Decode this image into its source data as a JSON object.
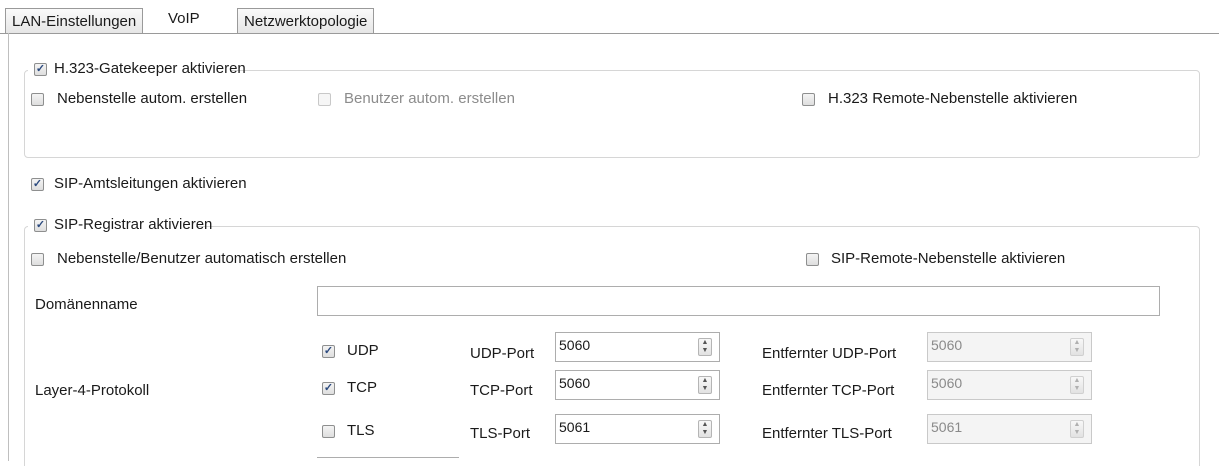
{
  "tabs": [
    {
      "label": "LAN-Einstellungen",
      "active": false
    },
    {
      "label": "VoIP",
      "active": true
    },
    {
      "label": "Netzwerktopologie",
      "active": false
    }
  ],
  "h323": {
    "title": "H.323-Gatekeeper aktivieren",
    "title_checked": true,
    "auto_extension": {
      "label": "Nebenstelle autom. erstellen",
      "checked": false
    },
    "auto_user": {
      "label": "Benutzer autom. erstellen",
      "checked": false,
      "disabled": true
    },
    "remote_extension": {
      "label": "H.323 Remote-Nebenstelle aktivieren",
      "checked": false
    }
  },
  "sip_trunks": {
    "label": "SIP-Amtsleitungen aktivieren",
    "checked": true
  },
  "sip_registrar": {
    "title": "SIP-Registrar aktivieren",
    "title_checked": true,
    "auto_create": {
      "label": "Nebenstelle/Benutzer automatisch erstellen",
      "checked": false
    },
    "remote_extension": {
      "label": "SIP-Remote-Nebenstelle aktivieren",
      "checked": false
    },
    "domain_label": "Domänenname",
    "domain_value": "",
    "layer4_label": "Layer-4-Protokoll",
    "protocols": [
      {
        "name": "UDP",
        "checked": true,
        "port_label": "UDP-Port",
        "port": "5060",
        "remote_label": "Entfernter UDP-Port",
        "remote_port": "5060"
      },
      {
        "name": "TCP",
        "checked": true,
        "port_label": "TCP-Port",
        "port": "5060",
        "remote_label": "Entfernter TCP-Port",
        "remote_port": "5060"
      },
      {
        "name": "TLS",
        "checked": false,
        "port_label": "TLS-Port",
        "port": "5061",
        "remote_label": "Entfernter TLS-Port",
        "remote_port": "5061"
      }
    ]
  },
  "icons": {
    "check": "checkmark-icon",
    "spin": "spin-arrows-icon"
  }
}
